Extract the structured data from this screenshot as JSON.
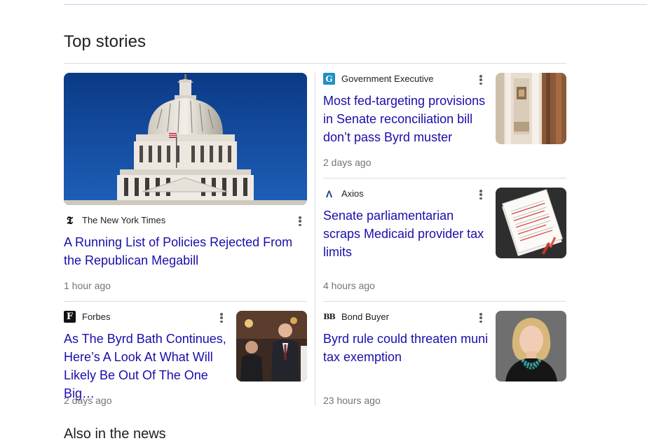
{
  "section_title": "Top stories",
  "footer_title": "Also in the news",
  "stories": [
    {
      "source": "The New York Times",
      "logo_glyph": "𝕿",
      "headline": "A Running List of Policies Rejected From the Republican Megabill",
      "time": "1 hour ago",
      "image": "us-capitol-dome"
    },
    {
      "source": "Government Executive",
      "logo_glyph": "G",
      "logo_color": "#1f8fc7",
      "headline": "Most fed-targeting provisions in Senate reconciliation bill don’t pass Byrd muster",
      "time": "2 days ago",
      "image": "government-interior"
    },
    {
      "source": "Axios",
      "logo_glyph": "Λ",
      "headline": "Senate parliamentarian scraps Medicaid provider tax limits",
      "time": "4 hours ago",
      "image": "marked-up-document"
    },
    {
      "source": "Forbes",
      "logo_glyph": "F",
      "headline": "As The Byrd Bath Continues, Here’s A Look At What Will Likely Be Out Of The One Big…",
      "time": "2 days ago",
      "image": "senators-walking"
    },
    {
      "source": "Bond Buyer",
      "logo_glyph": "BB",
      "headline": "Byrd rule could threaten muni tax exemption",
      "time": "23 hours ago",
      "image": "woman-portrait"
    }
  ],
  "colors": {
    "link": "#1a0dab",
    "meta": "#70757a",
    "divider": "#dadce0"
  }
}
